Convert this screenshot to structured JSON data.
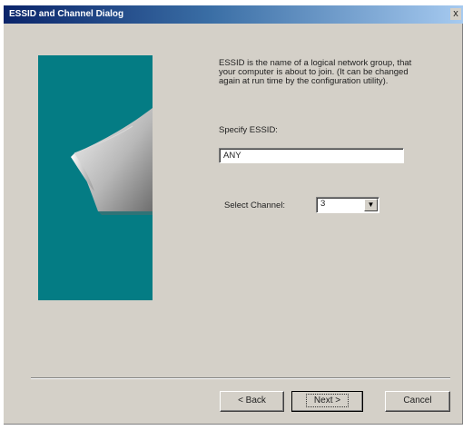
{
  "window": {
    "title": "ESSID and Channel Dialog",
    "close_glyph": "x"
  },
  "content": {
    "description": "ESSID is the name of a logical network group, that your computer is about to join. (It can be changed again at run time by the configuration utility).",
    "essid_label": "Specify ESSID:",
    "essid_value": "ANY",
    "channel_label": "Select Channel:",
    "channel_value": "3"
  },
  "buttons": {
    "back": "< Back",
    "next": "Next >",
    "cancel": "Cancel"
  },
  "colors": {
    "panel_teal": "#047c84",
    "dialog_face": "#d4d0c8",
    "titlebar_start": "#0a246a"
  },
  "icons": {
    "dropdown": "chevron-down-icon",
    "close": "close-icon",
    "wizard_art": "page-curl-graphic"
  }
}
